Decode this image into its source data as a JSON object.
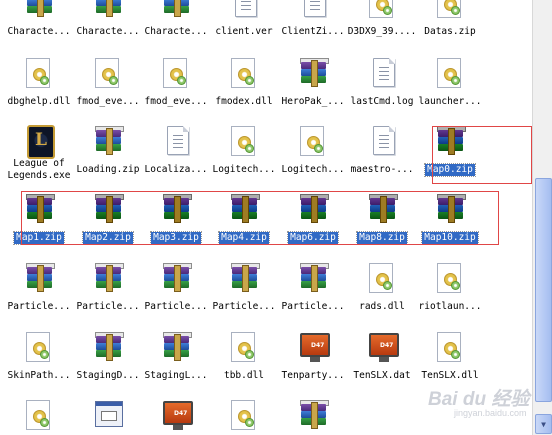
{
  "rows": [
    {
      "items": [
        {
          "label": "Characte...",
          "icon": "zip-archive-icon"
        },
        {
          "label": "Characte...",
          "icon": "zip-archive-icon"
        },
        {
          "label": "Characte...",
          "icon": "zip-archive-icon"
        },
        {
          "label": "client.ver",
          "icon": "text-file-icon"
        },
        {
          "label": "ClientZi...",
          "icon": "text-file-icon"
        },
        {
          "label": "D3DX9_39....",
          "icon": "dll-file-icon"
        },
        {
          "label": "Datas.zip",
          "icon": "dll-file-icon"
        }
      ]
    },
    {
      "items": [
        {
          "label": "dbghelp.dll",
          "icon": "dll-file-icon"
        },
        {
          "label": "fmod_eve...",
          "icon": "dll-file-icon"
        },
        {
          "label": "fmod_eve...",
          "icon": "dll-file-icon"
        },
        {
          "label": "fmodex.dll",
          "icon": "dll-file-icon"
        },
        {
          "label": "HeroPak_...",
          "icon": "zip-archive-icon"
        },
        {
          "label": "lastCmd.log",
          "icon": "text-file-icon"
        },
        {
          "label": "launcher...",
          "icon": "dll-file-icon"
        }
      ]
    },
    {
      "items": [
        {
          "label": "League of Legends.exe",
          "icon": "league-of-legends-icon"
        },
        {
          "label": "Loading.zip",
          "icon": "zip-archive-icon"
        },
        {
          "label": "Localiza...",
          "icon": "text-file-icon"
        },
        {
          "label": "Logitech...",
          "icon": "dll-file-icon"
        },
        {
          "label": "Logitech...",
          "icon": "dll-file-icon"
        },
        {
          "label": "maestro-...",
          "icon": "text-file-icon"
        },
        {
          "label": "Map0.zip",
          "icon": "zip-archive-icon",
          "selected": true
        }
      ]
    },
    {
      "items": [
        {
          "label": "Map1.zip",
          "icon": "zip-archive-icon",
          "selected": true
        },
        {
          "label": "Map2.zip",
          "icon": "zip-archive-icon",
          "selected": true
        },
        {
          "label": "Map3.zip",
          "icon": "zip-archive-icon",
          "selected": true
        },
        {
          "label": "Map4.zip",
          "icon": "zip-archive-icon",
          "selected": true
        },
        {
          "label": "Map6.zip",
          "icon": "zip-archive-icon",
          "selected": true
        },
        {
          "label": "Map8.zip",
          "icon": "zip-archive-icon",
          "selected": true
        },
        {
          "label": "Map10.zip",
          "icon": "zip-archive-icon",
          "selected": true
        }
      ]
    },
    {
      "items": [
        {
          "label": "Particle...",
          "icon": "zip-archive-icon"
        },
        {
          "label": "Particle...",
          "icon": "zip-archive-icon"
        },
        {
          "label": "Particle...",
          "icon": "zip-archive-icon"
        },
        {
          "label": "Particle...",
          "icon": "zip-archive-icon"
        },
        {
          "label": "Particle...",
          "icon": "zip-archive-icon"
        },
        {
          "label": "rads.dll",
          "icon": "dll-file-icon"
        },
        {
          "label": "riotlaun...",
          "icon": "dll-file-icon"
        }
      ]
    },
    {
      "items": [
        {
          "label": "SkinPath...",
          "icon": "dll-file-icon"
        },
        {
          "label": "StagingD...",
          "icon": "zip-archive-icon"
        },
        {
          "label": "StagingL...",
          "icon": "zip-archive-icon"
        },
        {
          "label": "tbb.dll",
          "icon": "dll-file-icon"
        },
        {
          "label": "Tenparty...",
          "icon": "monitor-app-icon"
        },
        {
          "label": "TenSLX.dat",
          "icon": "monitor-app-icon"
        },
        {
          "label": "TenSLX.dll",
          "icon": "dll-file-icon"
        }
      ]
    },
    {
      "items": [
        {
          "label": "",
          "icon": "dll-file-icon"
        },
        {
          "label": "",
          "icon": "dialog-window-icon"
        },
        {
          "label": "",
          "icon": "monitor-app-icon"
        },
        {
          "label": "",
          "icon": "dll-file-icon"
        },
        {
          "label": "",
          "icon": "zip-archive-icon"
        }
      ]
    }
  ],
  "monitor_icon_text": "D47",
  "watermark": {
    "main": "Bai du 经验",
    "sub": "jingyan.baidu.com"
  },
  "colors": {
    "selection": "#316ac5",
    "highlight_box": "#e04646"
  }
}
